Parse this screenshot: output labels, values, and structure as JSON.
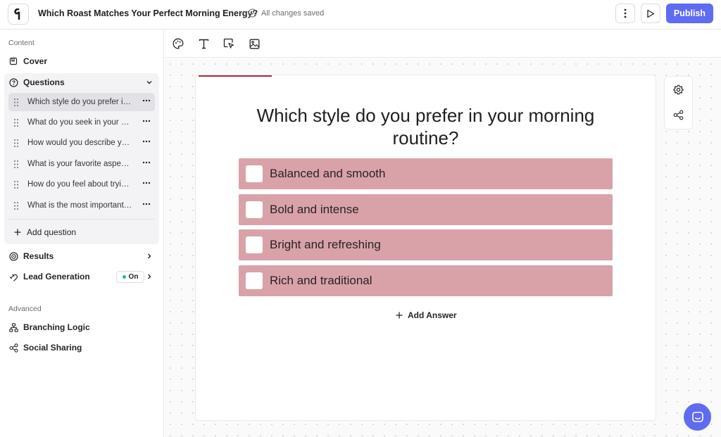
{
  "header": {
    "quiz_title": "Which Roast Matches Your Perfect Morning Energy?",
    "save_status": "All changes saved",
    "publish_label": "Publish"
  },
  "sidebar": {
    "content_label": "Content",
    "cover_label": "Cover",
    "questions_label": "Questions",
    "questions": [
      "Which style do you prefer in your morning routine?",
      "What do you seek in your morning coffee?",
      "How would you describe your ideal morning?",
      "What is your favorite aspect of coffee?",
      "How do you feel about trying new flavors?",
      "What is the most important part of your morning?"
    ],
    "add_question_label": "Add question",
    "results_label": "Results",
    "lead_generation_label": "Lead Generation",
    "lead_generation_status": "On",
    "advanced_label": "Advanced",
    "branching_logic_label": "Branching Logic",
    "social_sharing_label": "Social Sharing"
  },
  "editor": {
    "question_title": "Which style do you prefer in your morning routine?",
    "answers": [
      "Balanced and smooth",
      "Bold and intense",
      "Bright and refreshing",
      "Rich and traditional"
    ],
    "add_answer_label": "Add Answer"
  },
  "colors": {
    "accent": "#5f6bf0",
    "answer_fill": "#d9a2a9",
    "card_accent": "#a32c3c",
    "status_on": "#1fbf7a"
  }
}
